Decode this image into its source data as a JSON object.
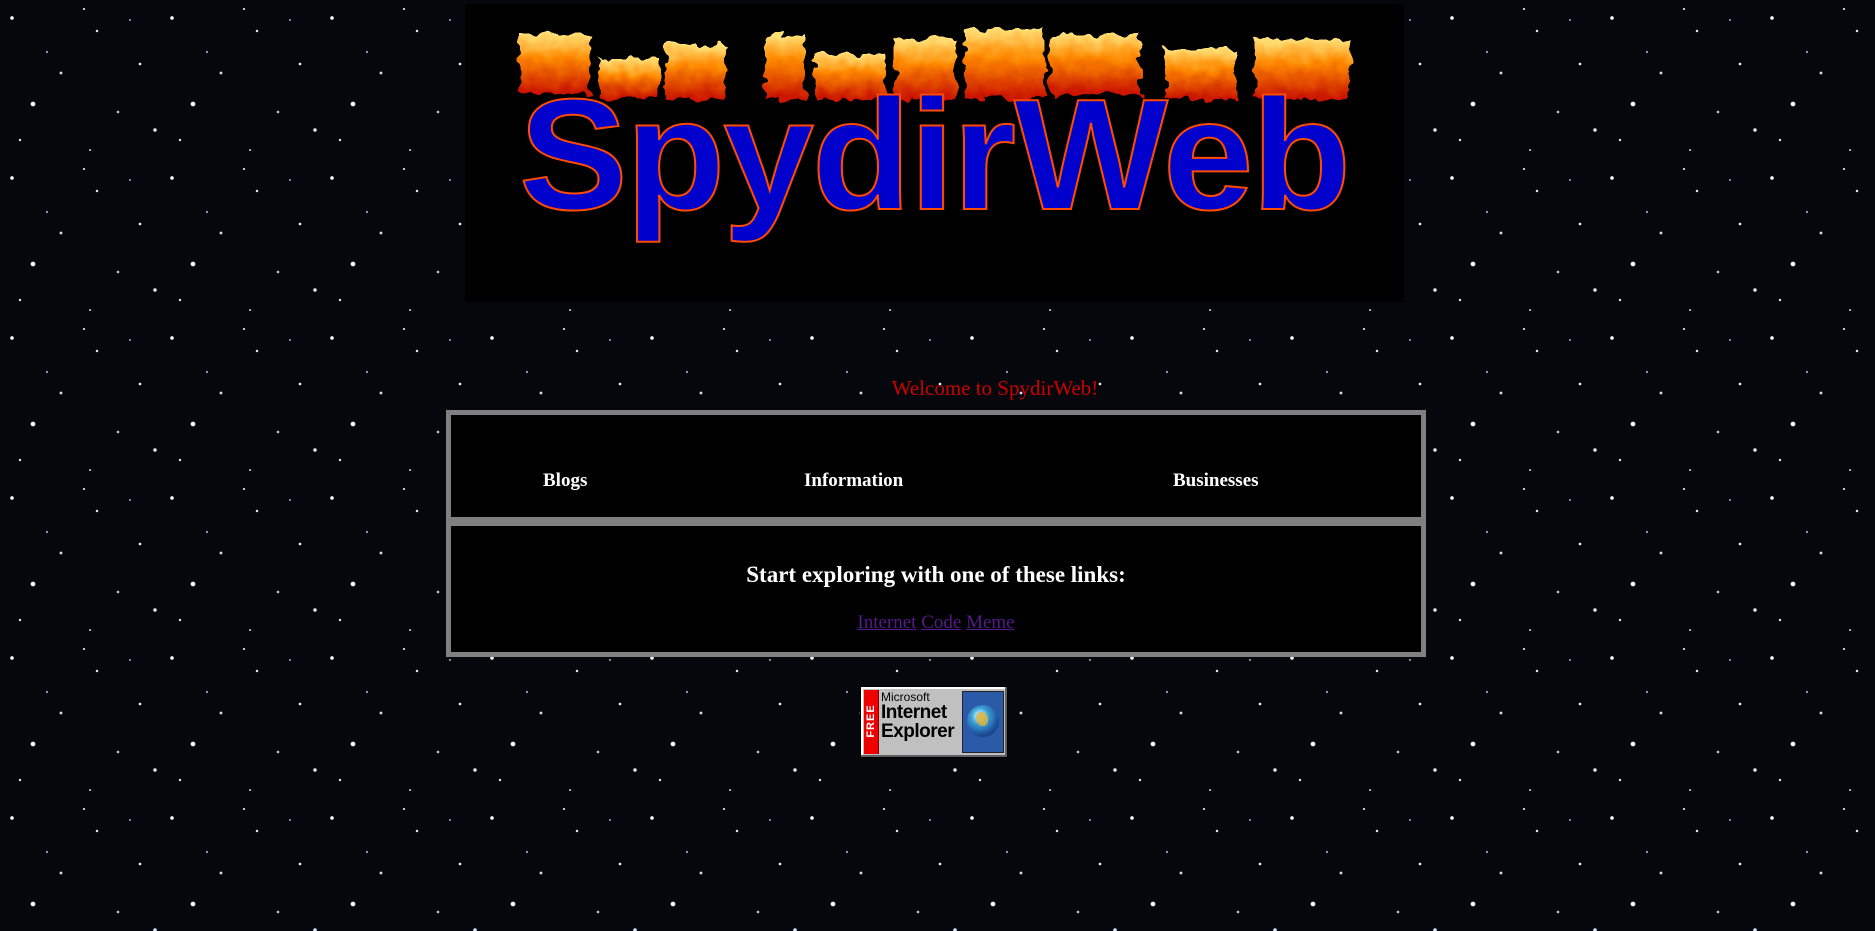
{
  "logo": {
    "text": "SpydirWeb"
  },
  "welcome": "Welcome to SpydirWeb!",
  "nav": {
    "blogs": "Blogs",
    "information": "Information",
    "businesses": "Businesses"
  },
  "explore": {
    "heading": "Start exploring with one of these links:",
    "links": [
      "Internet",
      "Code",
      "Meme"
    ]
  },
  "ie_badge": {
    "free": "FREE",
    "line1": "Microsoft",
    "line2": "Internet",
    "line3": "Explorer",
    "icon": "globe-icon"
  },
  "colors": {
    "welcome_text": "#cc0000",
    "link_visited": "#551a8b",
    "logo_fill": "#0000cc",
    "panel_border": "#808080"
  }
}
